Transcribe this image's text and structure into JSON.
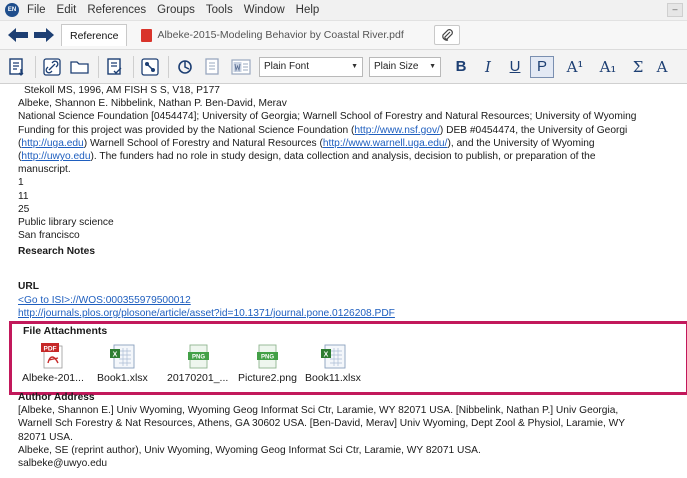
{
  "menu": {
    "app_badge": "EN",
    "items": [
      "File",
      "Edit",
      "References",
      "Groups",
      "Tools",
      "Window",
      "Help"
    ],
    "minimize": "–"
  },
  "tabs": {
    "reference": "Reference",
    "pdf": "Albeke-2015-Modeling Behavior by Coastal River.pdf"
  },
  "toolbar": {
    "font_select": "Plain Font",
    "size_select": "Plain Size",
    "bold": "B",
    "italic": "I",
    "underline": "U",
    "plain": "P",
    "superscript": "A¹",
    "subscript": "A₁",
    "symbol": "Σ",
    "more": "A"
  },
  "reference": {
    "line1": "Stekoll MS, 1996, AM FISH S S, V18, P177",
    "line2": "Albeke, Shannon E. Nibbelink, Nathan P. Ben-David, Merav",
    "line3": "National Science Foundation [0454474]; University of Georgia; Warnell School of Forestry and Natural Resources; University of Wyoming",
    "funding_a": "Funding for this project was provided by the National Science Foundation (",
    "funding_link1": "http://www.nsf.gov/",
    "funding_b": ") DEB #0454474, the University of Georgi",
    "funding_link2": "http://uga.edu",
    "funding_c": ") Warnell School of Forestry and Natural Resources (",
    "funding_link3": "http://www.warnell.uga.edu/",
    "funding_d": "), and the University of Wyoming",
    "funding_link4": "http://uwyo.edu",
    "funding_e": "). The funders had no role in study design, data collection and analysis, decision to publish, or preparation of the",
    "funding_f": "manuscript.",
    "v1": "1",
    "v2": "11",
    "v3": "25",
    "v4": "Public library science",
    "v5": "San francisco"
  },
  "research_notes": {
    "title": "Research Notes"
  },
  "url": {
    "title": "URL",
    "link1": "<Go to ISI>://WOS:000355979500012",
    "link2": "http://journals.plos.org/plosone/article/asset?id=10.1371/journal.pone.0126208.PDF"
  },
  "attachments": {
    "title": "File Attachments",
    "files": [
      {
        "name": "Albeke-201...",
        "type": "pdf",
        "badge": "PDF"
      },
      {
        "name": "Book1.xlsx",
        "type": "xlsx",
        "badge": "X"
      },
      {
        "name": "20170201_...",
        "type": "png",
        "badge": "PNG"
      },
      {
        "name": "Picture2.png",
        "type": "png",
        "badge": "PNG"
      },
      {
        "name": "Book11.xlsx",
        "type": "xlsx",
        "badge": "X"
      }
    ]
  },
  "author_address": {
    "title": "Author Address",
    "text1": "[Albeke, Shannon E.] Univ Wyoming, Wyoming Geog Informat Sci Ctr, Laramie, WY 82071 USA. [Nibbelink, Nathan P.] Univ Georgia,",
    "text2": "Warnell Sch Forestry & Nat Resources, Athens, GA 30602 USA. [Ben-David, Merav] Univ Wyoming, Dept Zool & Physiol, Laramie, WY",
    "text3": "82071 USA.",
    "text4": "Albeke, SE (reprint author), Univ Wyoming, Wyoming Geog Informat Sci Ctr, Laramie, WY 82071 USA.",
    "text5": "salbeke@uwyo.edu"
  },
  "colors": {
    "highlight_border": "#c2185b",
    "link": "#1f5fbf",
    "accent_blue": "#1d3f73"
  }
}
